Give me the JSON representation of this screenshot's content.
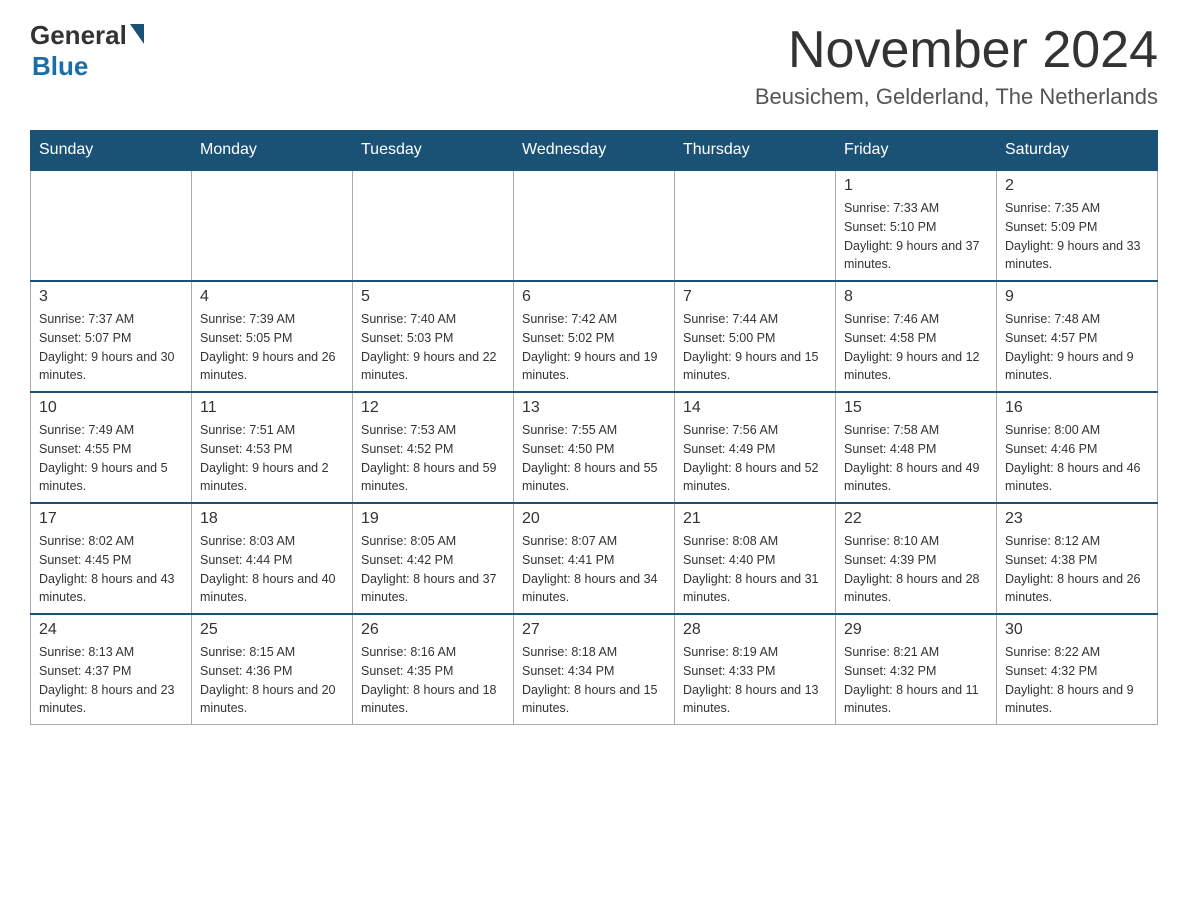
{
  "logo": {
    "text_general": "General",
    "text_blue": "Blue"
  },
  "header": {
    "month_year": "November 2024",
    "location": "Beusichem, Gelderland, The Netherlands"
  },
  "weekdays": [
    "Sunday",
    "Monday",
    "Tuesday",
    "Wednesday",
    "Thursday",
    "Friday",
    "Saturday"
  ],
  "weeks": [
    {
      "days": [
        {
          "num": "",
          "info": ""
        },
        {
          "num": "",
          "info": ""
        },
        {
          "num": "",
          "info": ""
        },
        {
          "num": "",
          "info": ""
        },
        {
          "num": "",
          "info": ""
        },
        {
          "num": "1",
          "info": "Sunrise: 7:33 AM\nSunset: 5:10 PM\nDaylight: 9 hours and 37 minutes."
        },
        {
          "num": "2",
          "info": "Sunrise: 7:35 AM\nSunset: 5:09 PM\nDaylight: 9 hours and 33 minutes."
        }
      ]
    },
    {
      "days": [
        {
          "num": "3",
          "info": "Sunrise: 7:37 AM\nSunset: 5:07 PM\nDaylight: 9 hours and 30 minutes."
        },
        {
          "num": "4",
          "info": "Sunrise: 7:39 AM\nSunset: 5:05 PM\nDaylight: 9 hours and 26 minutes."
        },
        {
          "num": "5",
          "info": "Sunrise: 7:40 AM\nSunset: 5:03 PM\nDaylight: 9 hours and 22 minutes."
        },
        {
          "num": "6",
          "info": "Sunrise: 7:42 AM\nSunset: 5:02 PM\nDaylight: 9 hours and 19 minutes."
        },
        {
          "num": "7",
          "info": "Sunrise: 7:44 AM\nSunset: 5:00 PM\nDaylight: 9 hours and 15 minutes."
        },
        {
          "num": "8",
          "info": "Sunrise: 7:46 AM\nSunset: 4:58 PM\nDaylight: 9 hours and 12 minutes."
        },
        {
          "num": "9",
          "info": "Sunrise: 7:48 AM\nSunset: 4:57 PM\nDaylight: 9 hours and 9 minutes."
        }
      ]
    },
    {
      "days": [
        {
          "num": "10",
          "info": "Sunrise: 7:49 AM\nSunset: 4:55 PM\nDaylight: 9 hours and 5 minutes."
        },
        {
          "num": "11",
          "info": "Sunrise: 7:51 AM\nSunset: 4:53 PM\nDaylight: 9 hours and 2 minutes."
        },
        {
          "num": "12",
          "info": "Sunrise: 7:53 AM\nSunset: 4:52 PM\nDaylight: 8 hours and 59 minutes."
        },
        {
          "num": "13",
          "info": "Sunrise: 7:55 AM\nSunset: 4:50 PM\nDaylight: 8 hours and 55 minutes."
        },
        {
          "num": "14",
          "info": "Sunrise: 7:56 AM\nSunset: 4:49 PM\nDaylight: 8 hours and 52 minutes."
        },
        {
          "num": "15",
          "info": "Sunrise: 7:58 AM\nSunset: 4:48 PM\nDaylight: 8 hours and 49 minutes."
        },
        {
          "num": "16",
          "info": "Sunrise: 8:00 AM\nSunset: 4:46 PM\nDaylight: 8 hours and 46 minutes."
        }
      ]
    },
    {
      "days": [
        {
          "num": "17",
          "info": "Sunrise: 8:02 AM\nSunset: 4:45 PM\nDaylight: 8 hours and 43 minutes."
        },
        {
          "num": "18",
          "info": "Sunrise: 8:03 AM\nSunset: 4:44 PM\nDaylight: 8 hours and 40 minutes."
        },
        {
          "num": "19",
          "info": "Sunrise: 8:05 AM\nSunset: 4:42 PM\nDaylight: 8 hours and 37 minutes."
        },
        {
          "num": "20",
          "info": "Sunrise: 8:07 AM\nSunset: 4:41 PM\nDaylight: 8 hours and 34 minutes."
        },
        {
          "num": "21",
          "info": "Sunrise: 8:08 AM\nSunset: 4:40 PM\nDaylight: 8 hours and 31 minutes."
        },
        {
          "num": "22",
          "info": "Sunrise: 8:10 AM\nSunset: 4:39 PM\nDaylight: 8 hours and 28 minutes."
        },
        {
          "num": "23",
          "info": "Sunrise: 8:12 AM\nSunset: 4:38 PM\nDaylight: 8 hours and 26 minutes."
        }
      ]
    },
    {
      "days": [
        {
          "num": "24",
          "info": "Sunrise: 8:13 AM\nSunset: 4:37 PM\nDaylight: 8 hours and 23 minutes."
        },
        {
          "num": "25",
          "info": "Sunrise: 8:15 AM\nSunset: 4:36 PM\nDaylight: 8 hours and 20 minutes."
        },
        {
          "num": "26",
          "info": "Sunrise: 8:16 AM\nSunset: 4:35 PM\nDaylight: 8 hours and 18 minutes."
        },
        {
          "num": "27",
          "info": "Sunrise: 8:18 AM\nSunset: 4:34 PM\nDaylight: 8 hours and 15 minutes."
        },
        {
          "num": "28",
          "info": "Sunrise: 8:19 AM\nSunset: 4:33 PM\nDaylight: 8 hours and 13 minutes."
        },
        {
          "num": "29",
          "info": "Sunrise: 8:21 AM\nSunset: 4:32 PM\nDaylight: 8 hours and 11 minutes."
        },
        {
          "num": "30",
          "info": "Sunrise: 8:22 AM\nSunset: 4:32 PM\nDaylight: 8 hours and 9 minutes."
        }
      ]
    }
  ]
}
